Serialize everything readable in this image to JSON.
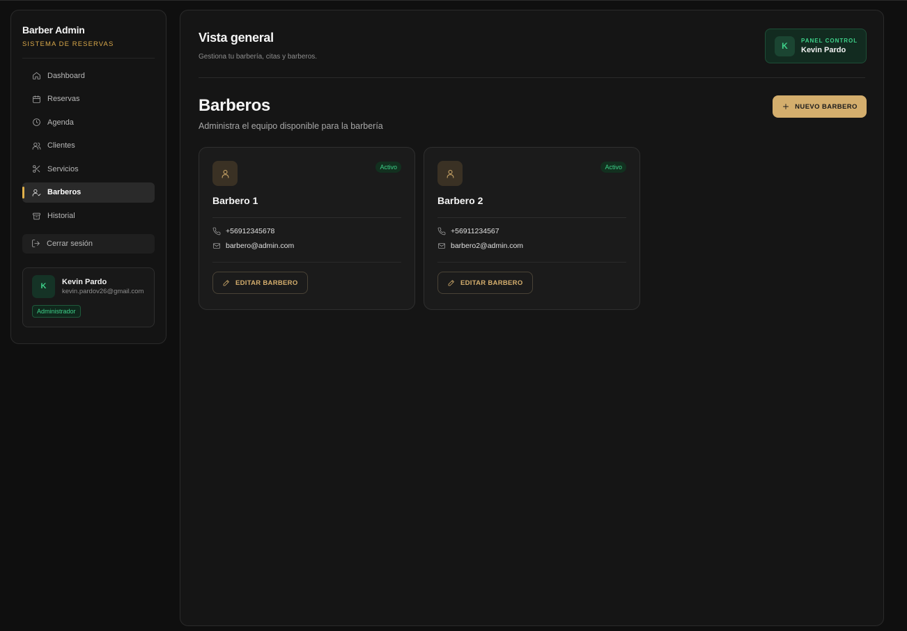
{
  "brand": {
    "title": "Barber Admin",
    "subtitle": "SISTEMA DE RESERVAS"
  },
  "sidebar": {
    "items": [
      {
        "label": "Dashboard",
        "icon": "home-icon"
      },
      {
        "label": "Reservas",
        "icon": "calendar-icon"
      },
      {
        "label": "Agenda",
        "icon": "clock-icon"
      },
      {
        "label": "Clientes",
        "icon": "users-icon"
      },
      {
        "label": "Servicios",
        "icon": "scissors-icon"
      },
      {
        "label": "Barberos",
        "icon": "user-check-icon",
        "active": true
      },
      {
        "label": "Historial",
        "icon": "archive-icon"
      }
    ],
    "logout_label": "Cerrar sesión"
  },
  "user": {
    "initial": "K",
    "name": "Kevin Pardo",
    "email": "kevin.pardov26@gmail.com",
    "role": "Administrador"
  },
  "header": {
    "title": "Vista general",
    "subtitle": "Gestiona tu barbería, citas y barberos.",
    "panel_label": "PANEL CONTROL",
    "panel_user": "Kevin Pardo",
    "panel_initial": "K"
  },
  "section": {
    "title": "Barberos",
    "subtitle": "Administra el equipo disponible para la barbería",
    "new_button": "NUEVO BARBERO"
  },
  "barbers": [
    {
      "name": "Barbero 1",
      "status": "Activo",
      "phone": "+56912345678",
      "email": "barbero@admin.com",
      "edit_label": "EDITAR BARBERO"
    },
    {
      "name": "Barbero 2",
      "status": "Activo",
      "phone": "+56911234567",
      "email": "barbero2@admin.com",
      "edit_label": "EDITAR BARBERO"
    }
  ],
  "colors": {
    "accent": "#d4ae6d",
    "active_green": "#3ed28a",
    "nav_indicator": "#e0b04a",
    "background": "#0f0f0f"
  }
}
